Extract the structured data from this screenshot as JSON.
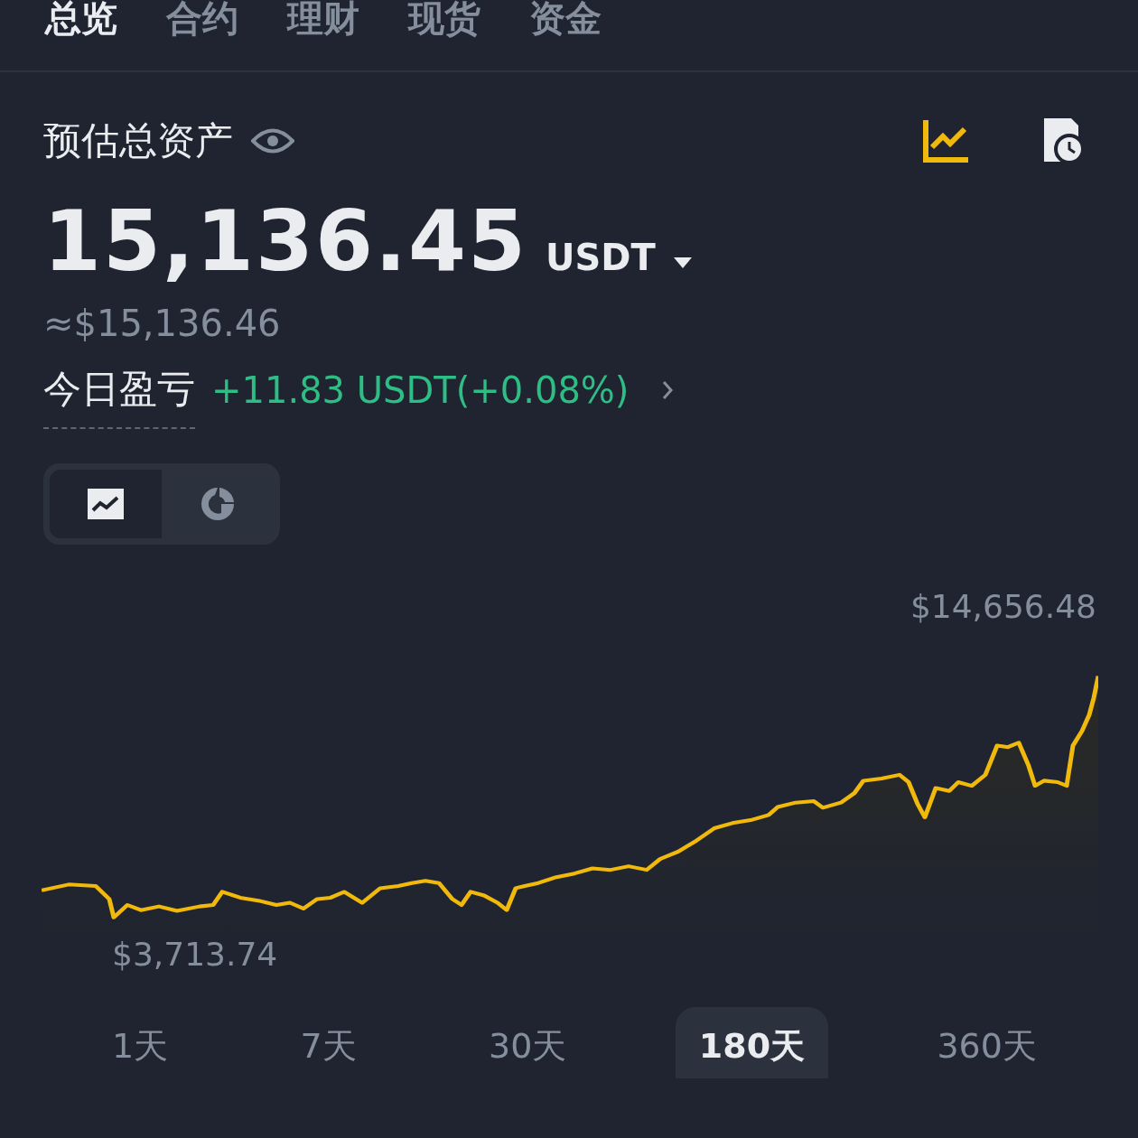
{
  "tabs": [
    {
      "label": "总览",
      "selected": true
    },
    {
      "label": "合约",
      "selected": false
    },
    {
      "label": "理财",
      "selected": false
    },
    {
      "label": "现货",
      "selected": false
    },
    {
      "label": "资金",
      "selected": false
    }
  ],
  "balance": {
    "title": "预估总资产",
    "amount": "15,136.45",
    "currency": "USDT",
    "approx": "≈$15,136.46"
  },
  "pnl": {
    "label": "今日盈亏",
    "value": "+11.83 USDT(+0.08%)"
  },
  "view_toggle": [
    {
      "kind": "line",
      "selected": true
    },
    {
      "kind": "pie",
      "selected": false
    }
  ],
  "chart": {
    "max_label": "$14,656.48",
    "min_label": "$3,713.74"
  },
  "periods": [
    {
      "label": "1天",
      "selected": false
    },
    {
      "label": "7天",
      "selected": false
    },
    {
      "label": "30天",
      "selected": false
    },
    {
      "label": "180天",
      "selected": true
    },
    {
      "label": "360天",
      "selected": false
    }
  ]
}
